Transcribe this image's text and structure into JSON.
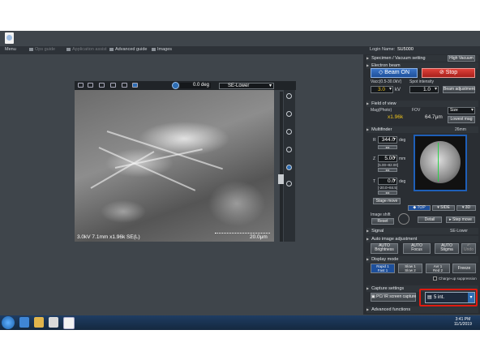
{
  "menubar": {
    "menu": "Menu",
    "ops_guide": "Ops guide",
    "application_assist": "Application assist",
    "advanced_guide": "Advanced guide",
    "images": "Images"
  },
  "login": {
    "label": "Login Name:",
    "value": "SU5000"
  },
  "image_window": {
    "rotation_value": "0.0",
    "rotation_unit": "deg",
    "detector": "SE-Lower",
    "info_label": "3.0kV 7.1mm x1.96k SE(L)",
    "scale_label": "20.0μm"
  },
  "panel": {
    "specimen_vacuum": {
      "title": "Specimen / Vacuum setting",
      "mode": "High Vacuum"
    },
    "electron_beam": {
      "title": "Electron beam",
      "beam_on": "Beam ON",
      "stop": "Stop",
      "vacc_label": "Vacc(0.5-30.0kV)",
      "vacc_value": "3.0",
      "vacc_unit": "kV",
      "spot_label": "Spot intensity",
      "spot_value": "1.0",
      "beam_adjustment": "Beam adjustment"
    },
    "field_of_view": {
      "title": "Field of view",
      "mag_label": "Mag(Photo)",
      "mag_value": "x1.96k",
      "fov_label": "FOV",
      "fov_value": "64.7μm",
      "size_option": "Size",
      "lowest_mag": "Lowest mag"
    },
    "multifinder": {
      "title": "Multifinder",
      "map_size": "26mm",
      "r_label": "R",
      "r_value": "344.0",
      "r_unit": "deg",
      "z_label": "Z",
      "z_value": "5.00",
      "z_unit": "mm",
      "z_range": "[5.00~82.00]",
      "t_label": "T",
      "t_value": "0.0",
      "t_unit": "deg",
      "t_range": "[-20.0~84.5]",
      "stage_move": "Stage move",
      "top": "TOP",
      "side": "SIDE",
      "view_3d": "3D",
      "image_shift": "Image shift",
      "reset": "Reset",
      "detail": "Detail",
      "step_move": "Step move"
    },
    "signal": {
      "title": "Signal",
      "value": "SE-Lower"
    },
    "auto_image": {
      "title": "Auto image adjustment",
      "brightness_top": "AUTO",
      "brightness": "Brightness",
      "focus_top": "AUTO",
      "focus": "Focus",
      "stigma_top": "AUTO",
      "stigma": "Stigma",
      "undo": "Undo"
    },
    "display_mode": {
      "title": "Display mode",
      "rapid_1": "Rapid 1",
      "fast_1": "Fast 1",
      "slow_1": "Slow 1",
      "slow_2": "Slow 2",
      "avg_1": "Avr 1",
      "red_2": "Red 2",
      "freeze": "Freeze",
      "chargeup": "Charge-up suppression"
    },
    "capture": {
      "title": "Capture settings",
      "pc_screen_capture": "PC/ IR screen capture",
      "capture_mode": "5 int."
    },
    "advanced": {
      "title": "Advanced functions"
    }
  },
  "taskbar": {
    "time": "3:41 PM",
    "date": "11/1/2019"
  },
  "colors": {
    "accent_blue": "#1d4f9b",
    "stop_red": "#c0281f",
    "highlight_red": "#e01b10",
    "value_yellow": "#f0c51b"
  }
}
